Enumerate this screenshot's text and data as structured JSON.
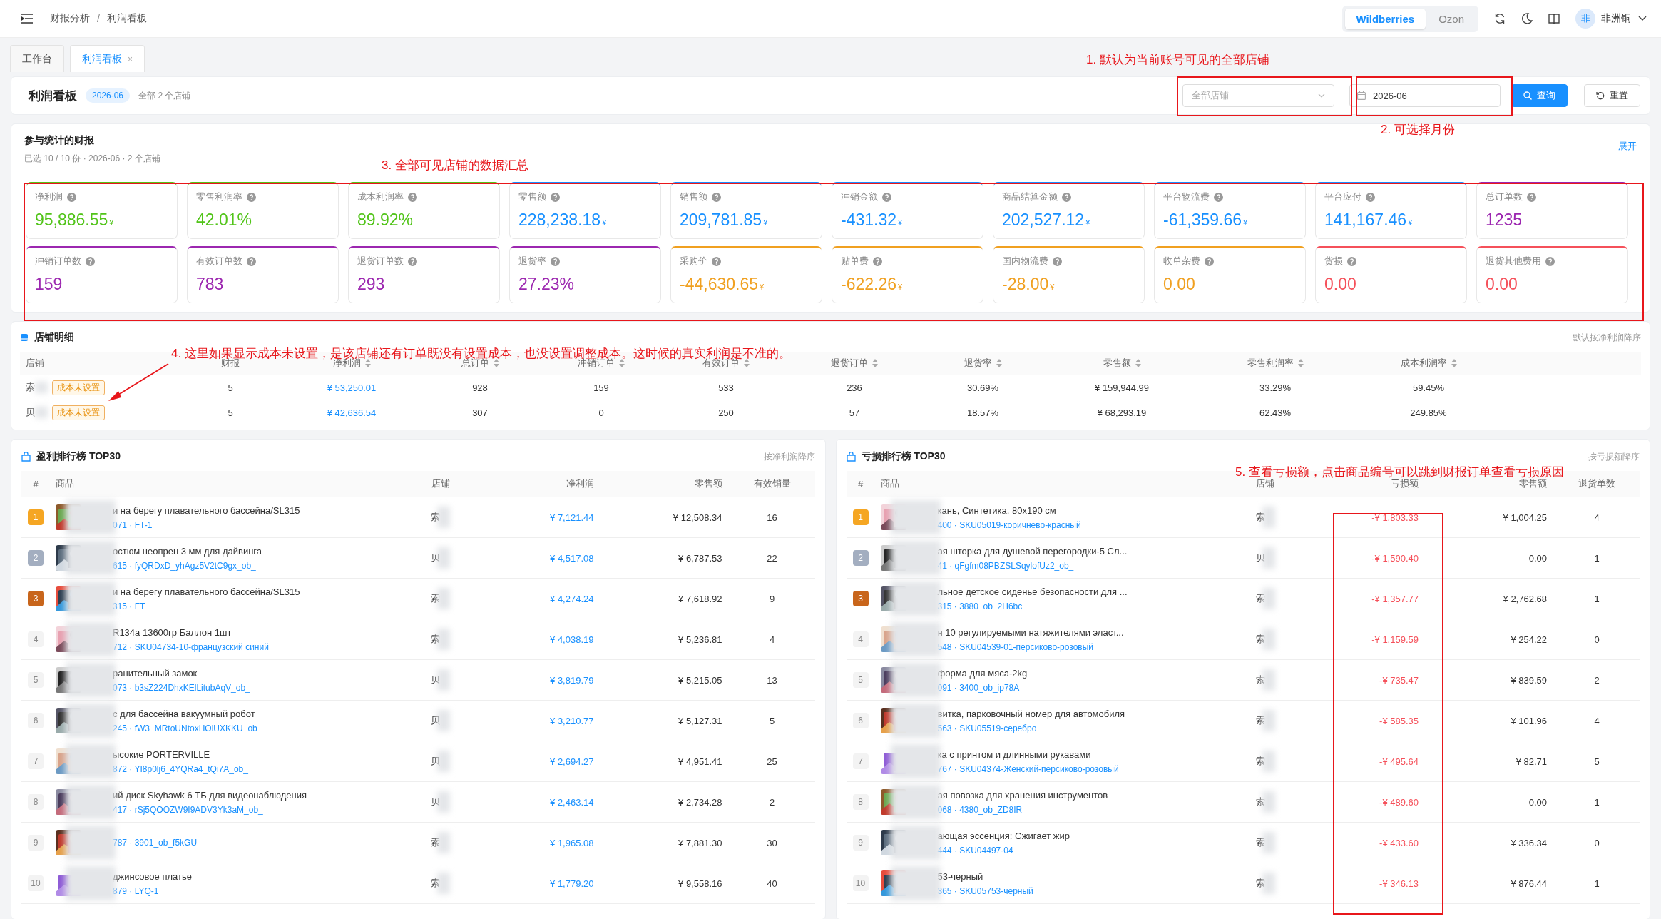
{
  "topbar": {
    "breadcrumb": [
      "财报分析",
      "利润看板"
    ],
    "separator": "/",
    "platforms": [
      {
        "label": "Wildberries",
        "selected": true
      },
      {
        "label": "Ozon",
        "selected": false
      }
    ],
    "user": {
      "avatar": "非",
      "name": "非洲铜"
    }
  },
  "tabs": [
    {
      "label": "工作台",
      "selected": false
    },
    {
      "label": "利润看板",
      "selected": true,
      "close": "×"
    }
  ],
  "header": {
    "title": "利润看板",
    "badge": "2026-06",
    "subtitle": "全部 2 个店铺",
    "store_select": {
      "placeholder": "全部店铺"
    },
    "month_field": {
      "value": "2026-06"
    },
    "buttons": [
      {
        "label": "查询",
        "kind": "primary"
      },
      {
        "label": "重置",
        "kind": "default"
      }
    ]
  },
  "reports": {
    "title": "参与统计的财报",
    "summary": "已选 10 / 10 份 · 2026-06 · 2 个店铺",
    "toggle": "展开"
  },
  "metrics": [
    {
      "label": "净利润",
      "value": "95,886.55",
      "unit": "¥",
      "color": "#52c41a"
    },
    {
      "label": "零售利润率",
      "value": "42.01%",
      "color": "#52c41a"
    },
    {
      "label": "成本利润率",
      "value": "89.92%",
      "color": "#52c41a"
    },
    {
      "label": "零售额",
      "value": "228,238.18",
      "unit": "¥",
      "color": "#1890ff"
    },
    {
      "label": "销售额",
      "value": "209,781.85",
      "unit": "¥",
      "color": "#1890ff"
    },
    {
      "label": "冲销金额",
      "value": "-431.32",
      "unit": "¥",
      "color": "#1890ff"
    },
    {
      "label": "商品结算金额",
      "value": "202,527.12",
      "unit": "¥",
      "color": "#1890ff"
    },
    {
      "label": "平台物流费",
      "value": "-61,359.66",
      "unit": "¥",
      "color": "#1890ff"
    },
    {
      "label": "平台应付",
      "value": "141,167.46",
      "unit": "¥",
      "color": "#1890ff"
    },
    {
      "label": "总订单数",
      "value": "1235",
      "color": "#9c27b0"
    },
    {
      "label": "冲销订单数",
      "value": "159",
      "color": "#9c27b0"
    },
    {
      "label": "有效订单数",
      "value": "783",
      "color": "#9c27b0"
    },
    {
      "label": "退货订单数",
      "value": "293",
      "color": "#9c27b0"
    },
    {
      "label": "退货率",
      "value": "27.23%",
      "color": "#9c27b0"
    },
    {
      "label": "采购价",
      "value": "-44,630.65",
      "unit": "¥",
      "color": "#f0a020"
    },
    {
      "label": "贴单费",
      "value": "-622.26",
      "unit": "¥",
      "color": "#f0a020"
    },
    {
      "label": "国内物流费",
      "value": "-28.00",
      "unit": "¥",
      "color": "#f0a020"
    },
    {
      "label": "收单杂费",
      "value": "0.00",
      "color": "#f0a020"
    },
    {
      "label": "货损",
      "value": "0.00",
      "color": "#f5505a"
    },
    {
      "label": "退货其他费用",
      "value": "0.00",
      "color": "#f5505a"
    }
  ],
  "stores": {
    "title": "店铺明细",
    "sort_hint": "默认按净利润降序",
    "columns": [
      {
        "label": "店铺",
        "sortable": false,
        "kind": "store"
      },
      {
        "label": "财报",
        "sortable": false,
        "kind": "text"
      },
      {
        "label": "净利润",
        "sortable": true,
        "kind": "link"
      },
      {
        "label": "总订单",
        "sortable": true,
        "kind": "text"
      },
      {
        "label": "冲销订单",
        "sortable": true,
        "kind": "text"
      },
      {
        "label": "有效订单",
        "sortable": true,
        "kind": "text"
      },
      {
        "label": "退货订单",
        "sortable": true,
        "kind": "text"
      },
      {
        "label": "退货率",
        "sortable": true,
        "kind": "text"
      },
      {
        "label": "零售额",
        "sortable": true,
        "kind": "text"
      },
      {
        "label": "零售利润率",
        "sortable": true,
        "kind": "text"
      },
      {
        "label": "成本利润率",
        "sortable": true,
        "kind": "text"
      }
    ],
    "rows": [
      {
        "tag": "成本未设置",
        "cells": [
          "索",
          "5",
          "¥ 53,250.01",
          "928",
          "159",
          "533",
          "236",
          "30.69%",
          "¥ 159,944.99",
          "33.29%",
          "59.45%"
        ]
      },
      {
        "tag": "成本未设置",
        "cells": [
          "贝",
          "5",
          "¥ 42,636.54",
          "307",
          "0",
          "250",
          "57",
          "18.57%",
          "¥ 68,293.19",
          "62.43%",
          "249.85%"
        ]
      }
    ]
  },
  "profit_ranking": {
    "title": "盈利排行榜 TOP30",
    "sort_hint": "按净利润降序",
    "columns": [
      "#",
      "商品",
      "店铺",
      "净利润",
      "零售额",
      "有效销量"
    ],
    "rows": [
      {
        "rank": "1",
        "kind": "gold",
        "name": "и на берегу плавательного бассейна/SL315",
        "code": "071 · FT-1",
        "store": "索",
        "amount": "¥ 7,121.44",
        "retail": "¥ 12,508.34",
        "count": "16"
      },
      {
        "rank": "2",
        "kind": "silver",
        "name": "остюм неопрен 3 мм для дайвинга",
        "code": "615 · fyQRDxD_yhAgz5V2tC9gx_ob_",
        "store": "贝",
        "amount": "¥ 4,517.08",
        "retail": "¥ 6,787.53",
        "count": "22"
      },
      {
        "rank": "3",
        "kind": "bronze",
        "name": "и на берегу плавательного бассейна/SL315",
        "code": "315 · FT",
        "store": "索",
        "amount": "¥ 4,274.24",
        "retail": "¥ 7,618.92",
        "count": "9"
      },
      {
        "rank": "4",
        "kind": "plain",
        "name": "R134a 13600гр Баллон 1шт",
        "code": "712 · SKU04734-10-французский синий",
        "store": "索",
        "amount": "¥ 4,038.19",
        "retail": "¥ 5,236.81",
        "count": "4"
      },
      {
        "rank": "5",
        "kind": "plain",
        "name": "ранительный замок",
        "code": "073 · b3sZ224DhxKElLitubAqV_ob_",
        "store": "贝",
        "amount": "¥ 3,819.79",
        "retail": "¥ 5,215.05",
        "count": "13"
      },
      {
        "rank": "6",
        "kind": "plain",
        "name": "с для бассейна вакуумный робот",
        "code": "245 · fW3_MRtoUNtoxHOlUXKKU_ob_",
        "store": "贝",
        "amount": "¥ 3,210.77",
        "retail": "¥ 5,127.31",
        "count": "5"
      },
      {
        "rank": "7",
        "kind": "plain",
        "name": "ысокие PORTERVILLE",
        "code": "872 · YI8p0lj6_4YQRa4_tQi7A_ob_",
        "store": "贝",
        "amount": "¥ 2,694.27",
        "retail": "¥ 4,951.41",
        "count": "25"
      },
      {
        "rank": "8",
        "kind": "plain",
        "name": "ий диск Skyhawk 6 ТБ для видеонаблюдения",
        "code": "417 · rSj5QOOZW9I9ADV3Yk3aM_ob_",
        "store": "贝",
        "amount": "¥ 2,463.14",
        "retail": "¥ 2,734.28",
        "count": "2"
      },
      {
        "rank": "9",
        "kind": "plain",
        "code": "787 · 3901_ob_f5kGU",
        "store": "索",
        "amount": "¥ 1,965.08",
        "retail": "¥ 7,881.30",
        "count": "30"
      },
      {
        "rank": "10",
        "kind": "plain",
        "name": "джинсовое платье",
        "code": "879 · LYQ-1",
        "store": "索",
        "amount": "¥ 1,779.20",
        "retail": "¥ 9,558.16",
        "count": "40"
      }
    ]
  },
  "loss_ranking": {
    "title": "亏损排行榜 TOP30",
    "sort_hint": "按亏损额降序",
    "columns": [
      "#",
      "商品",
      "店铺",
      "亏损额",
      "零售额",
      "退货单数"
    ],
    "rows": [
      {
        "rank": "1",
        "kind": "gold",
        "name": "кань, Синтетика, 80x190 см",
        "code": "400 · SKU05019-коричнево-красный",
        "store": "索",
        "amount": "-¥ 1,803.33",
        "retail": "¥ 1,004.25",
        "count": "4"
      },
      {
        "rank": "2",
        "kind": "silver",
        "name": "ая шторка для душевой перегородки-5 Сл...",
        "code": "41 · qFgfm08PBZSLSqylofUz2_ob_",
        "store": "贝",
        "amount": "-¥ 1,590.40",
        "retail": "0.00",
        "count": "1"
      },
      {
        "rank": "3",
        "kind": "bronze",
        "name": "льное детское сиденье безопасности для ...",
        "code": "315 · 3880_ob_2H6bc",
        "store": "索",
        "amount": "-¥ 1,357.77",
        "retail": "¥ 2,762.68",
        "count": "1"
      },
      {
        "rank": "4",
        "kind": "plain",
        "name": "н 10 регулируемыми натяжителями эласт...",
        "code": "548 · SKU04539-01-персиково-розовый",
        "store": "索",
        "amount": "-¥ 1,159.59",
        "retail": "¥ 254.22",
        "count": "0"
      },
      {
        "rank": "5",
        "kind": "plain",
        "name": "форма для мяса-2kg",
        "code": "091 · 3400_ob_ip78A",
        "store": "索",
        "amount": "-¥ 735.47",
        "retail": "¥ 839.59",
        "count": "2"
      },
      {
        "rank": "6",
        "kind": "plain",
        "name": "витка, парковочный номер для автомобиля",
        "code": "563 · SKU05519-серебро",
        "store": "索",
        "amount": "-¥ 585.35",
        "retail": "¥ 101.96",
        "count": "4"
      },
      {
        "rank": "7",
        "kind": "plain",
        "name": "ка с принтом и длинными рукавами",
        "code": "767 · SKU04374-Женский-персиково-розовый",
        "store": "索",
        "amount": "-¥ 495.64",
        "retail": "¥ 82.71",
        "count": "5"
      },
      {
        "rank": "8",
        "kind": "plain",
        "name": "ая повозка для хранения инструментов",
        "code": "068 · 4380_ob_ZD8IR",
        "store": "索",
        "amount": "-¥ 489.60",
        "retail": "0.00",
        "count": "1"
      },
      {
        "rank": "9",
        "kind": "plain",
        "name": "ающая эссенция: Сжигает жир",
        "code": "444 · SKU04497-04",
        "store": "索",
        "amount": "-¥ 433.60",
        "retail": "¥ 336.34",
        "count": "0"
      },
      {
        "rank": "10",
        "kind": "plain",
        "name": "53-черный",
        "code": "365 · SKU05753-черный",
        "store": "索",
        "amount": "-¥ 346.13",
        "retail": "¥ 876.44",
        "count": "1"
      }
    ]
  },
  "annotations": [
    {
      "text": "1. 默认为当前账号可见的全部店铺"
    },
    {
      "text": "2. 可选择月份"
    },
    {
      "text": "3. 全部可见店铺的数据汇总"
    },
    {
      "text": "4. 这里如果显示成本未设置，是该店铺还有订单既没有设置成本，也没设置调整成本。这时候的真实利润是不准的。"
    },
    {
      "text": "5. 查看亏损额，点击商品编号可以跳到财报订单查看亏损原因"
    }
  ]
}
